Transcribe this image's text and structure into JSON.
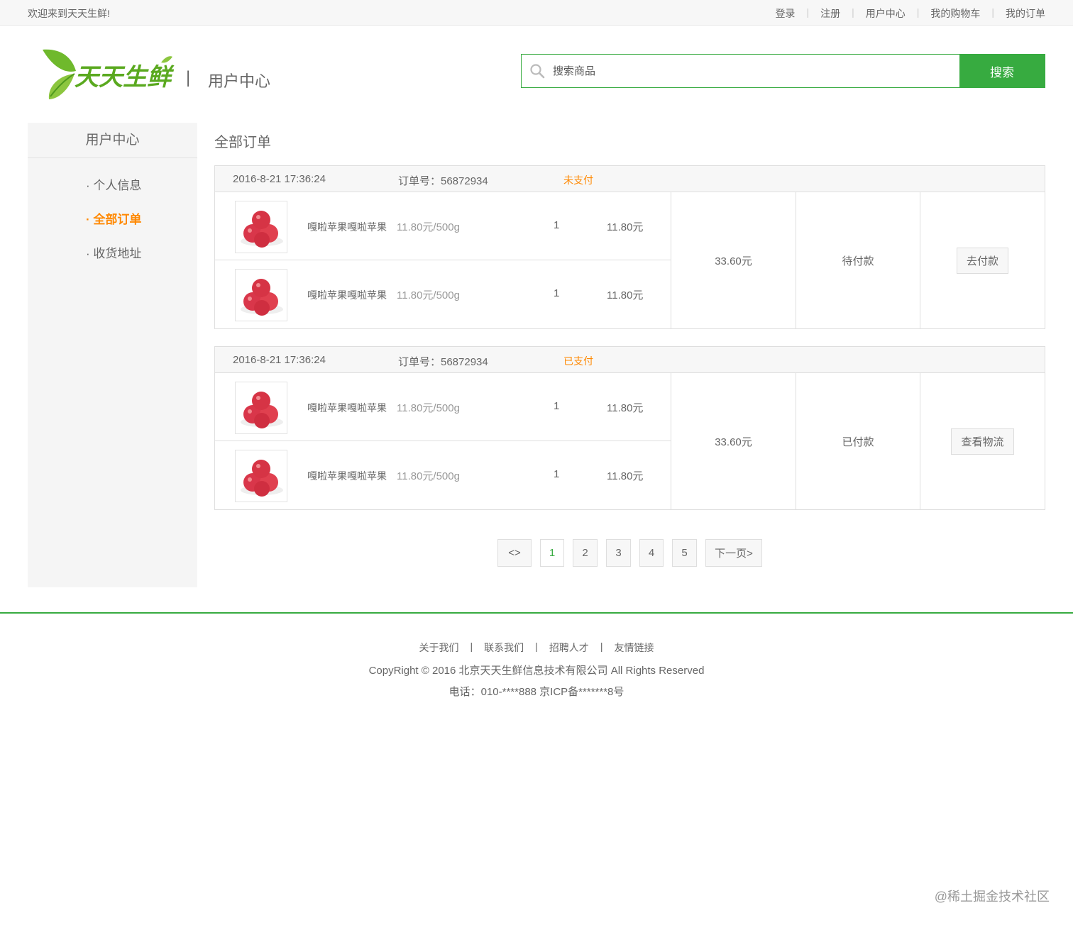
{
  "topbar": {
    "welcome": "欢迎来到天天生鲜!",
    "links": [
      "登录",
      "注册",
      "用户中心",
      "我的购物车",
      "我的订单"
    ]
  },
  "header": {
    "logo_text": "天天生鲜",
    "divider": "|",
    "section": "用户中心",
    "search_placeholder": "搜索商品",
    "search_button": "搜索",
    "brand_color": "#37ab40"
  },
  "sidebar": {
    "title": "用户中心",
    "items": [
      {
        "label": "· 个人信息",
        "active": false
      },
      {
        "label": "· 全部订单",
        "active": true
      },
      {
        "label": "· 收货地址",
        "active": false
      }
    ]
  },
  "main": {
    "title": "全部订单",
    "orders": [
      {
        "date": "2016-8-21 17:36:24",
        "order_no": "订单号：56872934",
        "pay_status": "未支付",
        "items": [
          {
            "name": "嘎啦苹果嘎啦苹果",
            "price": "11.80元/500g",
            "qty": "1",
            "subtotal": "11.80元"
          },
          {
            "name": "嘎啦苹果嘎啦苹果",
            "price": "11.80元/500g",
            "qty": "1",
            "subtotal": "11.80元"
          }
        ],
        "total": "33.60元",
        "status": "待付款",
        "action": "去付款"
      },
      {
        "date": "2016-8-21 17:36:24",
        "order_no": "订单号：56872934",
        "pay_status": "已支付",
        "items": [
          {
            "name": "嘎啦苹果嘎啦苹果",
            "price": "11.80元/500g",
            "qty": "1",
            "subtotal": "11.80元"
          },
          {
            "name": "嘎啦苹果嘎啦苹果",
            "price": "11.80元/500g",
            "qty": "1",
            "subtotal": "11.80元"
          }
        ],
        "total": "33.60元",
        "status": "已付款",
        "action": "查看物流"
      }
    ]
  },
  "pagination": {
    "prev": "<>",
    "pages": [
      "1",
      "2",
      "3",
      "4",
      "5"
    ],
    "current": "1",
    "next": "下一页>"
  },
  "footer": {
    "links": [
      "关于我们",
      "联系我们",
      "招聘人才",
      "友情链接"
    ],
    "separator": "|",
    "copyright": "CopyRight © 2016 北京天天生鲜信息技术有限公司 All Rights Reserved",
    "tel": "电话：010-****888 京ICP备*******8号"
  },
  "watermark": "@稀土掘金技术社区",
  "colors": {
    "accent": "#37ab40",
    "highlight": "#ff8800"
  }
}
